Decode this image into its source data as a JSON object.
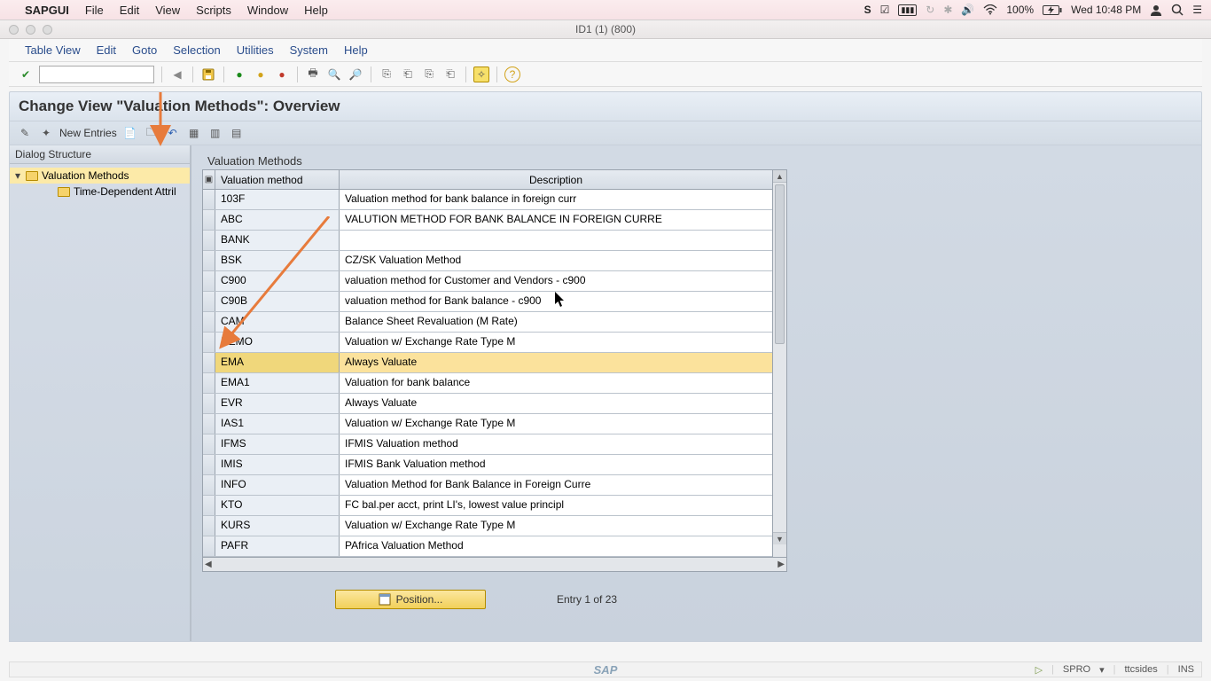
{
  "mac": {
    "app_name": "SAPGUI",
    "menus": [
      "File",
      "Edit",
      "View",
      "Scripts",
      "Window",
      "Help"
    ],
    "battery_pct": "100%",
    "clock": "Wed 10:48 PM"
  },
  "window": {
    "title": "ID1 (1) (800)"
  },
  "sap_menu": [
    "Table View",
    "Edit",
    "Goto",
    "Selection",
    "Utilities",
    "System",
    "Help"
  ],
  "view": {
    "title": "Change View \"Valuation Methods\": Overview",
    "new_entries_label": "New Entries"
  },
  "tree": {
    "header": "Dialog Structure",
    "root": "Valuation Methods",
    "child": "Time-Dependent Attril"
  },
  "table": {
    "panel_title": "Valuation Methods",
    "headers": {
      "col1": "Valuation method",
      "col2": "Description"
    },
    "rows": [
      {
        "code": "103F",
        "desc": "Valuation method for bank balance in foreign curr",
        "hl": false
      },
      {
        "code": "ABC",
        "desc": "VALUTION METHOD FOR BANK BALANCE IN FOREIGN CURRE",
        "hl": false
      },
      {
        "code": "BANK",
        "desc": "",
        "hl": false
      },
      {
        "code": "BSK",
        "desc": "CZ/SK Valuation Method",
        "hl": false
      },
      {
        "code": "C900",
        "desc": "valuation method for Customer and Vendors - c900",
        "hl": false
      },
      {
        "code": "C90B",
        "desc": "valuation method for Bank balance - c900",
        "hl": false
      },
      {
        "code": "CAM",
        "desc": "Balance Sheet Revaluation (M Rate)",
        "hl": false
      },
      {
        "code": "DEMO",
        "desc": "Valuation w/ Exchange Rate Type M",
        "hl": false
      },
      {
        "code": "EMA",
        "desc": "Always Valuate",
        "hl": true
      },
      {
        "code": "EMA1",
        "desc": "Valuation for bank balance",
        "hl": false
      },
      {
        "code": "EVR",
        "desc": "Always Valuate",
        "hl": false
      },
      {
        "code": "IAS1",
        "desc": "Valuation w/ Exchange Rate Type M",
        "hl": false
      },
      {
        "code": "IFMS",
        "desc": "IFMIS Valuation method",
        "hl": false
      },
      {
        "code": "IMIS",
        "desc": "IFMIS Bank Valuation method",
        "hl": false
      },
      {
        "code": "INFO",
        "desc": "Valuation Method for Bank Balance in Foreign Curre",
        "hl": false
      },
      {
        "code": "KTO",
        "desc": "FC bal.per acct, print LI's, lowest value principl",
        "hl": false
      },
      {
        "code": "KURS",
        "desc": "Valuation w/ Exchange Rate Type M",
        "hl": false
      },
      {
        "code": "PAFR",
        "desc": "PAfrica Valuation Method",
        "hl": false
      }
    ]
  },
  "footer": {
    "position_label": "Position...",
    "entry_text": "Entry 1 of 23"
  },
  "status": {
    "tcode": "SPRO",
    "session": "ttcsides",
    "ins": "INS"
  }
}
